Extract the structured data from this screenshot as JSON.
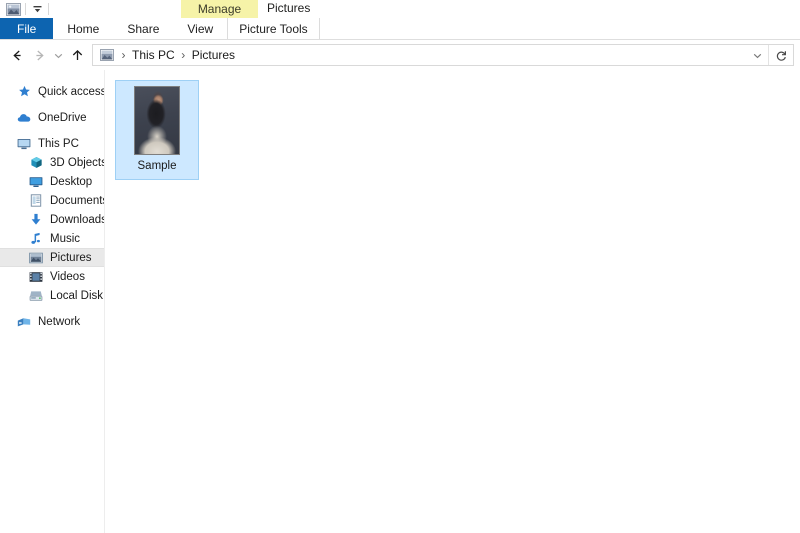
{
  "window": {
    "title": "Pictures",
    "contextual_group": "Manage",
    "qat": {
      "folder_icon": "pictures-folder-icon",
      "dropdown_icon": "chevron-down-icon"
    }
  },
  "ribbon": {
    "tabs": [
      {
        "label": "File",
        "type": "file",
        "active": false
      },
      {
        "label": "Home",
        "type": "normal",
        "active": false
      },
      {
        "label": "Share",
        "type": "normal",
        "active": false
      },
      {
        "label": "View",
        "type": "normal",
        "active": false
      },
      {
        "label": "Picture Tools",
        "type": "contextual",
        "active": false
      }
    ]
  },
  "navbar": {
    "back_icon": "arrow-left-icon",
    "forward_icon": "arrow-right-icon",
    "recent_icon": "chevron-down-icon",
    "up_icon": "arrow-up-icon",
    "breadcrumbs": [
      {
        "label": "This PC"
      },
      {
        "label": "Pictures"
      }
    ],
    "separator": "›",
    "dropdown_icon": "chevron-down-icon",
    "refresh_icon": "refresh-icon"
  },
  "sidebar": {
    "items": [
      {
        "label": "Quick access",
        "icon": "star-icon",
        "level": 0,
        "selected": false
      },
      {
        "label": "OneDrive",
        "icon": "cloud-icon",
        "level": 0,
        "selected": false
      },
      {
        "label": "This PC",
        "icon": "monitor-icon",
        "level": 0,
        "selected": false
      },
      {
        "label": "3D Objects",
        "icon": "cube-icon",
        "level": 1,
        "selected": false
      },
      {
        "label": "Desktop",
        "icon": "desktop-icon",
        "level": 1,
        "selected": false
      },
      {
        "label": "Documents",
        "icon": "document-icon",
        "level": 1,
        "selected": false
      },
      {
        "label": "Downloads",
        "icon": "download-icon",
        "level": 1,
        "selected": false
      },
      {
        "label": "Music",
        "icon": "music-note-icon",
        "level": 1,
        "selected": false
      },
      {
        "label": "Pictures",
        "icon": "picture-icon",
        "level": 1,
        "selected": true
      },
      {
        "label": "Videos",
        "icon": "video-icon",
        "level": 1,
        "selected": false
      },
      {
        "label": "Local Disk (C:)",
        "icon": "drive-icon",
        "level": 1,
        "selected": false
      },
      {
        "label": "Network",
        "icon": "network-icon",
        "level": 0,
        "selected": false
      }
    ]
  },
  "content": {
    "files": [
      {
        "name": "Sample",
        "type": "image",
        "selected": true
      }
    ]
  },
  "colors": {
    "file_tab_blue": "#0d64b0",
    "contextual_yellow": "#f6f3a8",
    "selection_blue": "#cde8ff",
    "selection_border": "#9ed0f5",
    "sidebar_selected": "#e9e9e9"
  }
}
